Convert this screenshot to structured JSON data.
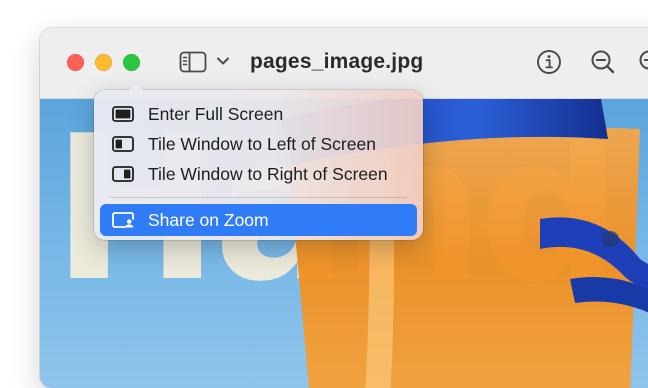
{
  "window": {
    "title": "pages_image.jpg"
  },
  "toolbar": {
    "icons": [
      "sidebar-icon",
      "chevron-down-icon",
      "info-icon",
      "zoom-out-icon",
      "zoom-in-icon"
    ]
  },
  "image": {
    "background_text": "Hand"
  },
  "menu": {
    "items": [
      {
        "label": "Enter Full Screen",
        "icon": "full-screen-icon"
      },
      {
        "label": "Tile Window to Left of Screen",
        "icon": "tile-left-icon"
      },
      {
        "label": "Tile Window to Right of Screen",
        "icon": "tile-right-icon"
      },
      {
        "label": "Share on Zoom",
        "icon": "share-zoom-icon",
        "highlighted": true
      }
    ]
  },
  "colors": {
    "close": "#ff5f57",
    "minimize": "#febc2e",
    "zoom": "#28c840",
    "menu_highlight": "#2f7cf6"
  }
}
